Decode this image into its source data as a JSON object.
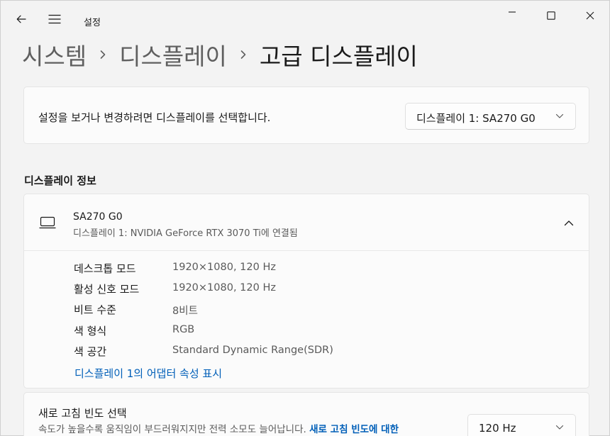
{
  "app": {
    "title": "설정",
    "icons": {
      "back": "back-arrow-icon",
      "menu": "hamburger-menu-icon",
      "minimize": "minimize-icon",
      "maximize": "maximize-icon",
      "close": "close-icon"
    }
  },
  "breadcrumb": {
    "items": [
      "시스템",
      "디스플레이",
      "고급 디스플레이"
    ],
    "separator_icon": "chevron-right-icon"
  },
  "display_select": {
    "prompt": "설정을 보거나 변경하려면 디스플레이를 선택합니다.",
    "selected": "디스플레이 1: SA270 G0"
  },
  "display_info": {
    "section_title": "디스플레이 정보",
    "monitor_name": "SA270 G0",
    "connection": "디스플레이 1: NVIDIA GeForce RTX 3070 Ti에 연결됨",
    "rows": [
      {
        "label": "데스크톱 모드",
        "value": "1920×1080, 120 Hz"
      },
      {
        "label": "활성 신호 모드",
        "value": "1920×1080, 120 Hz"
      },
      {
        "label": "비트 수준",
        "value": "8비트"
      },
      {
        "label": "색 형식",
        "value": "RGB"
      },
      {
        "label": "색 공간",
        "value": "Standard Dynamic Range(SDR)"
      }
    ],
    "adapter_link": "디스플레이 1의 어댑터 속성 표시"
  },
  "refresh_rate": {
    "title": "새로 고침 빈도 선택",
    "description": "속도가 높을수록 움직임이 부드러워지지만 전력 소모도 늘어납니다.",
    "link_text": "새로 고침 빈도에 대한",
    "selected": "120 Hz"
  },
  "colors": {
    "background": "#f3f3f3",
    "card": "#fbfbfb",
    "accent_link": "#005fb8",
    "secondary_text": "#5a5a5a"
  }
}
